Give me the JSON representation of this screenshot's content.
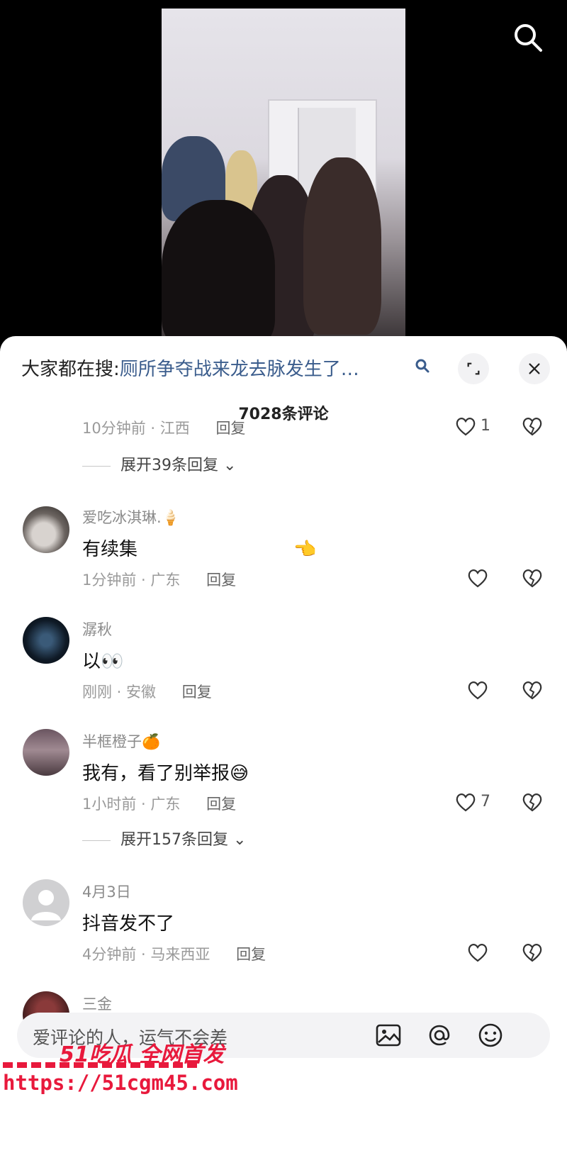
{
  "header": {
    "search_icon": "search-icon"
  },
  "panel": {
    "search_prefix": "大家都在搜:",
    "search_query": "厕所争夺战来龙去脉发生了…",
    "comment_count": "7028条评论"
  },
  "top_reply": {
    "meta": "10分钟前 · 江西",
    "reply": "回复",
    "likes": "1",
    "expand": "展开39条回复"
  },
  "comments": [
    {
      "username": "爱吃冰淇琳.🍦",
      "text": "有续集",
      "emoji": "👈",
      "meta": "1分钟前 · 广东",
      "reply": "回复",
      "likes": ""
    },
    {
      "username": "潺秋",
      "text": "以👀",
      "meta": "刚刚 · 安徽",
      "reply": "回复",
      "likes": ""
    },
    {
      "username": "半框橙子🍊",
      "text": "我有，看了别举报😅",
      "meta": "1小时前 · 广东",
      "reply": "回复",
      "likes": "7",
      "expand": "展开157条回复"
    },
    {
      "username": "4月3日",
      "text": "抖音发不了",
      "meta": "4分钟前 · 马来西亚",
      "reply": "回复",
      "likes": ""
    },
    {
      "username": "三金"
    }
  ],
  "input": {
    "placeholder": "爱评论的人，运气不会差"
  },
  "watermark": {
    "line1": "51吃瓜 全网首发",
    "line2": "https://51cgm45.com"
  },
  "colors": {
    "accent_link": "#3a5c8c",
    "watermark": "#e8193c"
  }
}
